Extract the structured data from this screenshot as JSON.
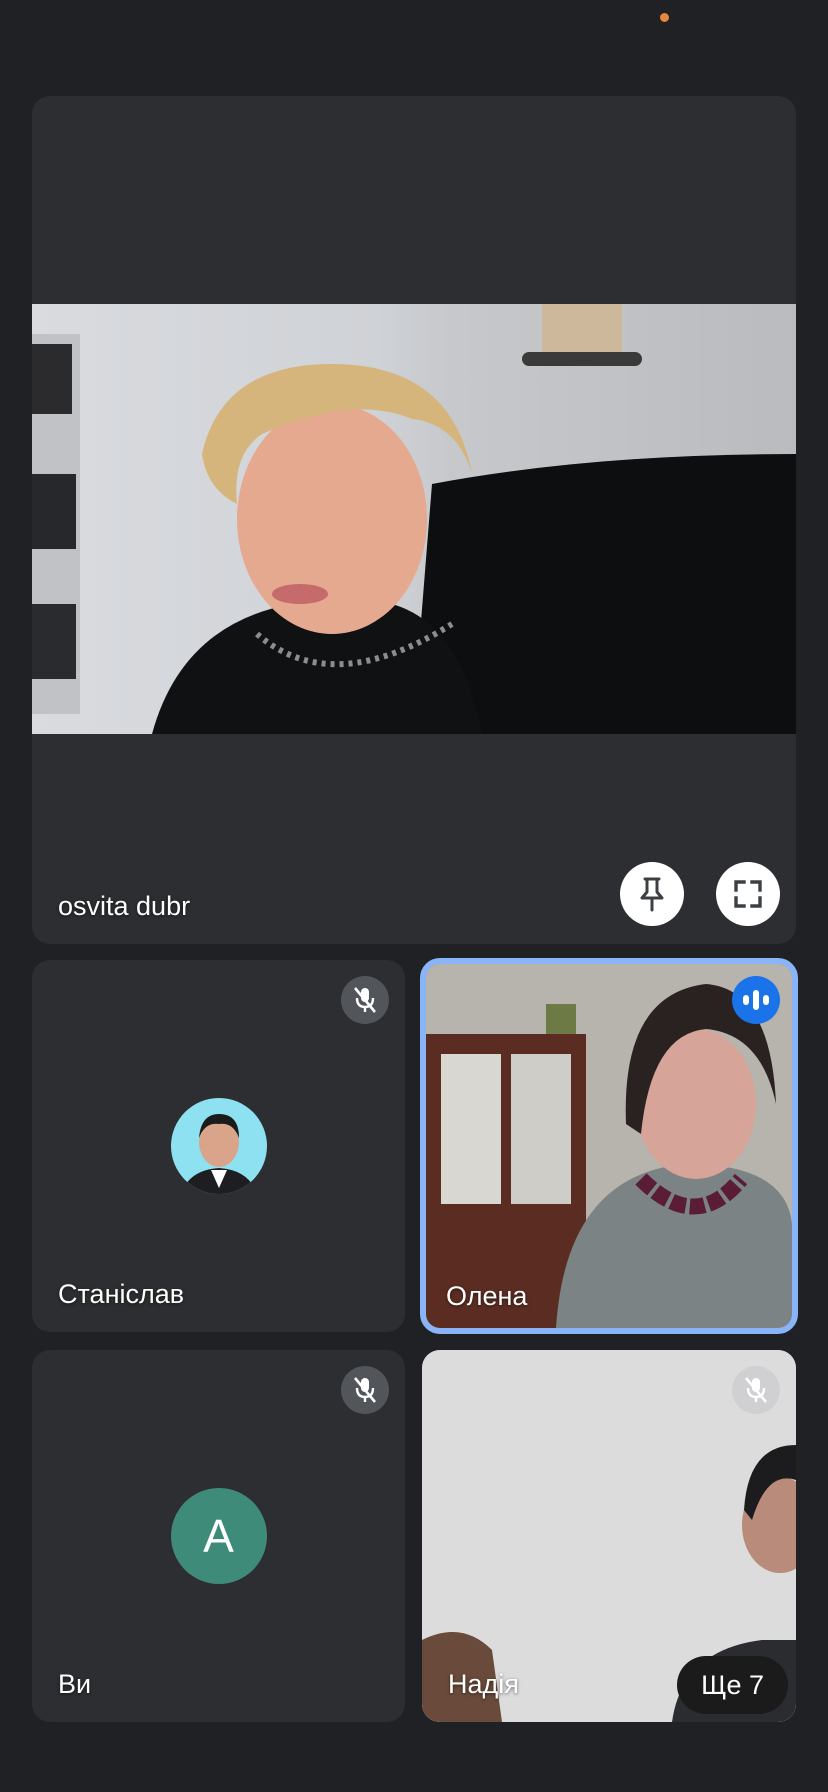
{
  "featured": {
    "name": "osvita dubr",
    "pin_icon": "pin-icon",
    "fullscreen_icon": "fullscreen-icon"
  },
  "participants": [
    {
      "name": "Станіслав",
      "status_icon": "mic-off-icon"
    },
    {
      "name": "Олена",
      "status_icon": "speaking-icon",
      "highlight_color": "#8ab4f8"
    },
    {
      "name": "Ви",
      "avatar_letter": "A",
      "avatar_color": "#3e8b7a",
      "status_icon": "mic-off-icon"
    },
    {
      "name": "Надія",
      "status_icon": "mic-off-icon"
    }
  ],
  "more": {
    "label": "Ще 7"
  },
  "colors": {
    "background": "#202124",
    "tile": "#2d2e31",
    "accent": "#1a73e8",
    "status_dot": "#e8873a"
  }
}
